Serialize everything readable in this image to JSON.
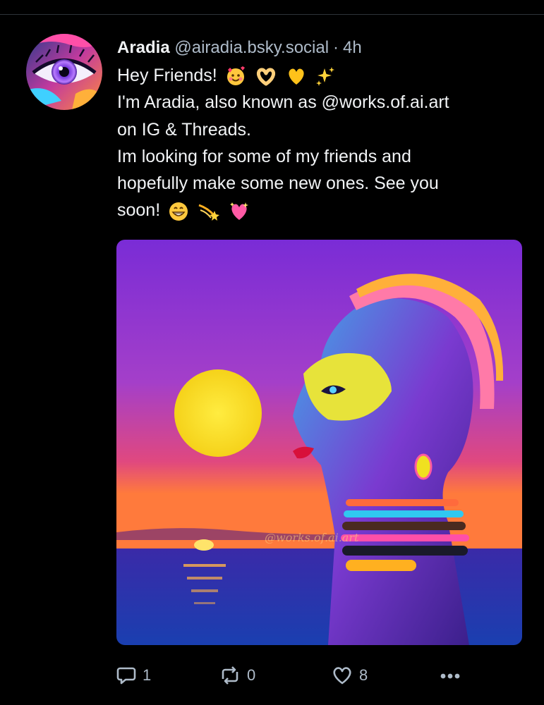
{
  "post": {
    "author_name": "Aradia",
    "handle": "@airadia.bsky.social",
    "separator": "·",
    "time": "4h",
    "lines": [
      "Hey Friends!",
      "I'm Aradia, also known as @works.of.ai.art",
      "on IG & Threads.",
      "Im looking for some of my friends and",
      "hopefully make some new ones. See you",
      "soon!"
    ],
    "line1_emojis": [
      "smiling-face-with-hearts",
      "heart-hands",
      "yellow-heart",
      "sparkles"
    ],
    "line6_emojis": [
      "beaming-face",
      "dizzy",
      "sparkling-heart"
    ],
    "image_watermark": "@works.of.ai.art"
  },
  "actions": {
    "reply_count": "1",
    "repost_count": "0",
    "like_count": "8"
  },
  "colors": {
    "background": "#000000",
    "text": "#f1f3f5",
    "muted": "#aebbc9"
  }
}
